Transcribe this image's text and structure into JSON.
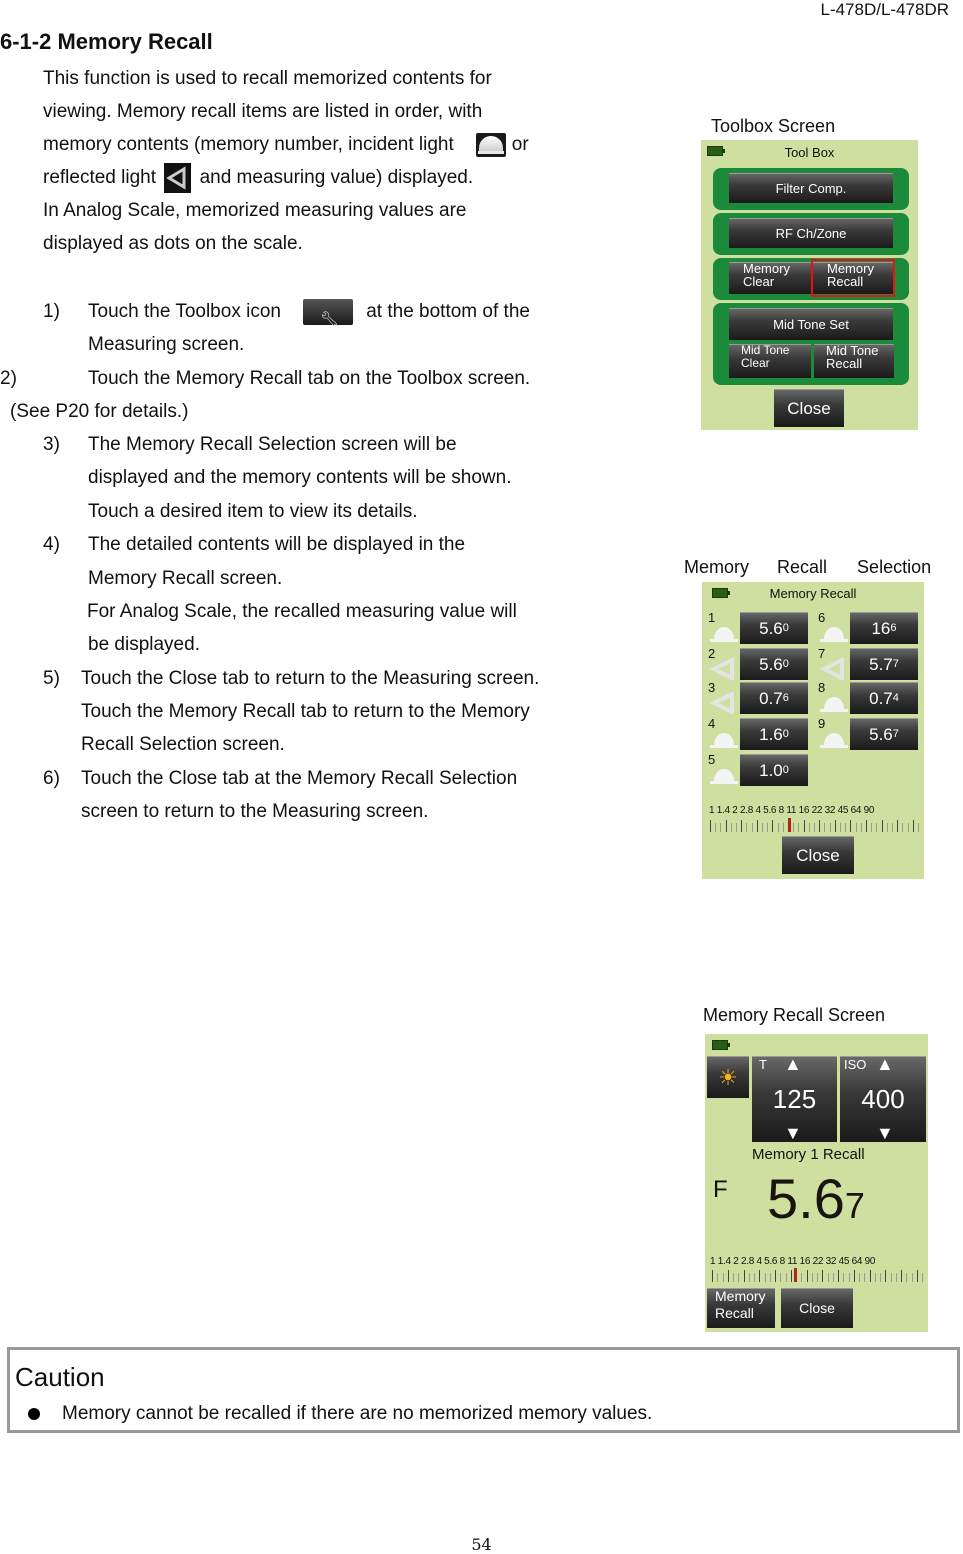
{
  "header": {
    "model": "L-478D/L-478DR"
  },
  "section": {
    "title": "6-1-2 Memory Recall",
    "intro": [
      "This function is used to recall memorized contents for",
      "viewing. Memory recall items are listed in order, with",
      "memory contents (memory number, incident light",
      "or",
      "reflected light",
      "and measuring value) displayed.",
      "In Analog Scale, memorized measuring values are",
      "displayed as dots on the scale."
    ],
    "icons": {
      "incident": "incident-light-icon",
      "reflected": "reflected-light-icon",
      "toolbox": "wrench-icon"
    },
    "steps": {
      "s1_num": "1)",
      "s1_a": "Touch the Toolbox icon",
      "s1_b": "at the bottom of the",
      "s1_c": "Measuring screen.",
      "s2_num": "2)",
      "s2_a": "Touch the Memory Recall tab on the Toolbox screen.",
      "s2_b": "(See P20 for details.)",
      "s3_num": "3)",
      "s3_a": "The Memory Recall Selection screen will be",
      "s3_b": "displayed and the memory contents will be shown.",
      "s3_c": "Touch a desired item to view its details.",
      "s4_num": "4)",
      "s4_a": "The detailed contents will be displayed in the",
      "s4_b": "Memory Recall screen.",
      "s4_c": "For Analog Scale, the recalled measuring value will",
      "s4_d": "be displayed.",
      "s5_num": "5)",
      "s5_a": "Touch the Close tab to return to the Measuring screen.",
      "s5_b": "Touch the Memory Recall tab to return to the Memory",
      "s5_c": "Recall Selection screen.",
      "s6_num": "6)",
      "s6_a": "Touch the Close tab at the Memory Recall Selection",
      "s6_b": "screen to return to the Measuring screen."
    }
  },
  "toolbox_screen": {
    "caption": "Toolbox Screen",
    "title": "Tool Box",
    "buttons": {
      "filter": "Filter Comp.",
      "rf": "RF Ch/Zone",
      "mem_clear_1": "Memory",
      "mem_clear_2": "Clear",
      "mem_recall_1": "Memory",
      "mem_recall_2": "Recall",
      "midtone_set": "Mid Tone Set",
      "midtone_clear_1": "Mid Tone",
      "midtone_clear_2": "Clear",
      "midtone_recall_1": "Mid Tone",
      "midtone_recall_2": "Recall",
      "close": "Close"
    },
    "highlight_color": "#e8101a"
  },
  "selection_screen": {
    "caption_1": "Memory",
    "caption_2": "Recall",
    "caption_3": "Selection",
    "title": "Memory Recall",
    "memories": [
      {
        "num": "1",
        "type": "incident",
        "main": "5.6",
        "sub": "0"
      },
      {
        "num": "2",
        "type": "reflected",
        "main": "5.6",
        "sub": "0"
      },
      {
        "num": "3",
        "type": "reflected",
        "main": "0.7",
        "sub": "6"
      },
      {
        "num": "4",
        "type": "incident",
        "main": "1.6",
        "sub": "0"
      },
      {
        "num": "5",
        "type": "incident",
        "main": "1.0",
        "sub": "0"
      },
      {
        "num": "6",
        "type": "incident",
        "main": "16",
        "sub": "6"
      },
      {
        "num": "7",
        "type": "reflected",
        "main": "5.7",
        "sub": "7"
      },
      {
        "num": "8",
        "type": "incident",
        "main": "0.7",
        "sub": "4"
      },
      {
        "num": "9",
        "type": "incident",
        "main": "5.6",
        "sub": "7"
      }
    ],
    "scale_labels": "1  1.4  2  2.8  4  5.6  8  11  16  22 32  45  64  90",
    "close": "Close"
  },
  "recall_screen": {
    "caption": "Memory Recall Screen",
    "mode_icon": "sun-icon",
    "t_label": "T",
    "t_value": "125",
    "iso_label": "ISO",
    "iso_value": "400",
    "memory_title": "Memory 1 Recall",
    "f_label": "F",
    "f_main": "5.6",
    "f_sub": "7",
    "scale_labels": "1  1.4  2  2.8  4  5.6  8  11  16  22 32  45  64  90",
    "memory_recall_1": "Memory",
    "memory_recall_2": "Recall",
    "close": "Close"
  },
  "caution": {
    "title": "Caution",
    "item": "Memory cannot be recalled if there are no memorized memory values."
  },
  "footer": {
    "page": "54"
  }
}
